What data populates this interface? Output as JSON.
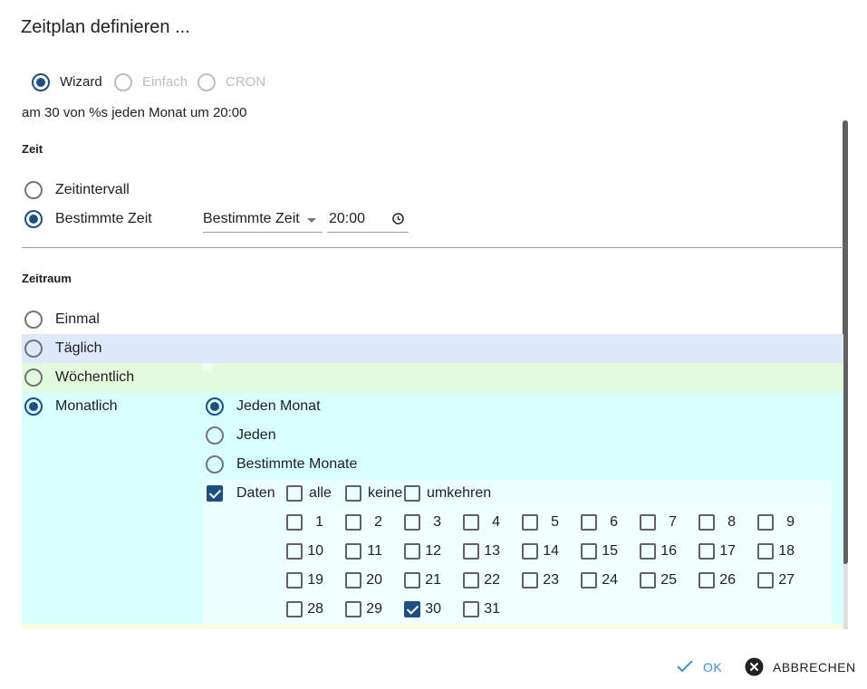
{
  "dialog": {
    "title": "Zeitplan definieren ..."
  },
  "mode": {
    "options": [
      {
        "label": "Wizard",
        "selected": true,
        "disabled": false
      },
      {
        "label": "Einfach",
        "selected": false,
        "disabled": true
      },
      {
        "label": "CRON",
        "selected": false,
        "disabled": true
      }
    ],
    "summary": "am 30 von %s jeden Monat um 20:00"
  },
  "zeit": {
    "heading": "Zeit",
    "interval_label": "Zeitintervall",
    "specific_label": "Bestimmte Zeit",
    "select_value": "Bestimmte Zeit",
    "time_value": "20:00"
  },
  "zeitraum": {
    "heading": "Zeitraum",
    "once_label": "Einmal",
    "daily_label": "Täglich",
    "weekly_label": "Wöchentlich",
    "monthly_label": "Monatlich",
    "monthly": {
      "every_month_label": "Jeden Monat",
      "every_label": "Jeden",
      "specific_months_label": "Bestimmte Monate",
      "dates_label": "Daten",
      "all_label": "alle",
      "none_label": "keine",
      "invert_label": "umkehren"
    }
  },
  "days": {
    "labels": [
      "1",
      "2",
      "3",
      "4",
      "5",
      "6",
      "7",
      "8",
      "9",
      "10",
      "11",
      "12",
      "13",
      "14",
      "15",
      "16",
      "17",
      "18",
      "19",
      "20",
      "21",
      "22",
      "23",
      "24",
      "25",
      "26",
      "27",
      "28",
      "29",
      "30",
      "31"
    ],
    "checked": [
      30
    ]
  },
  "actions": {
    "ok_label": "OK",
    "cancel_label": "ABBRECHEN"
  },
  "colors": {
    "primary": "#1f4f82",
    "ok": "#3f8fcf"
  }
}
